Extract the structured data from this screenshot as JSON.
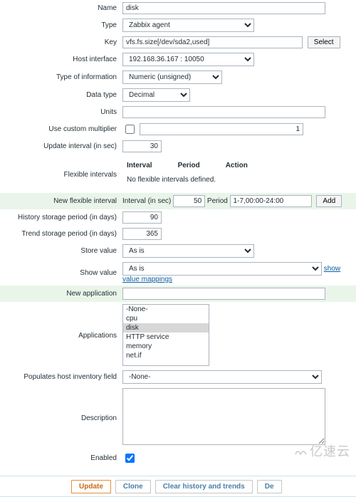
{
  "labels": {
    "name": "Name",
    "type": "Type",
    "key": "Key",
    "hostif": "Host interface",
    "typeinfo": "Type of information",
    "datatype": "Data type",
    "units": "Units",
    "custmult": "Use custom multiplier",
    "updint": "Update interval (in sec)",
    "flexint": "Flexible intervals",
    "newflex": "New flexible interval",
    "histper": "History storage period (in days)",
    "trendper": "Trend storage period (in days)",
    "storeval": "Store value",
    "showval": "Show value",
    "newapp": "New application",
    "apps": "Applications",
    "popinv": "Populates host inventory field",
    "desc": "Description",
    "enabled": "Enabled"
  },
  "values": {
    "name": "disk",
    "type": "Zabbix agent",
    "key": "vfs.fs.size[/dev/sda2,used]",
    "hostif": "192.168.36.167 : 10050",
    "typeinfo": "Numeric (unsigned)",
    "datatype": "Decimal",
    "units": "",
    "mult": "1",
    "updint": "30",
    "newflex_sec": "50",
    "newflex_period": "1-7,00:00-24:00",
    "hist": "90",
    "trend": "365",
    "storeval": "As is",
    "showval": "As is",
    "newapp": "",
    "popinv": "-None-",
    "desc": ""
  },
  "cols": {
    "interval": "Interval",
    "period": "Period",
    "action": "Action"
  },
  "text": {
    "noflex": "No flexible intervals defined.",
    "intsec": "Interval (in sec)",
    "periodlbl": "Period",
    "showmap": "show value mappings",
    "select": "Select",
    "add": "Add",
    "watermark": "亿速云"
  },
  "apps": {
    "items": [
      "-None-",
      "cpu",
      "disk",
      "HTTP service",
      "memory",
      "net.if"
    ],
    "selected": "disk"
  },
  "footer": {
    "update": "Update",
    "clone": "Clone",
    "clear": "Clear history and trends",
    "delete": "De"
  }
}
